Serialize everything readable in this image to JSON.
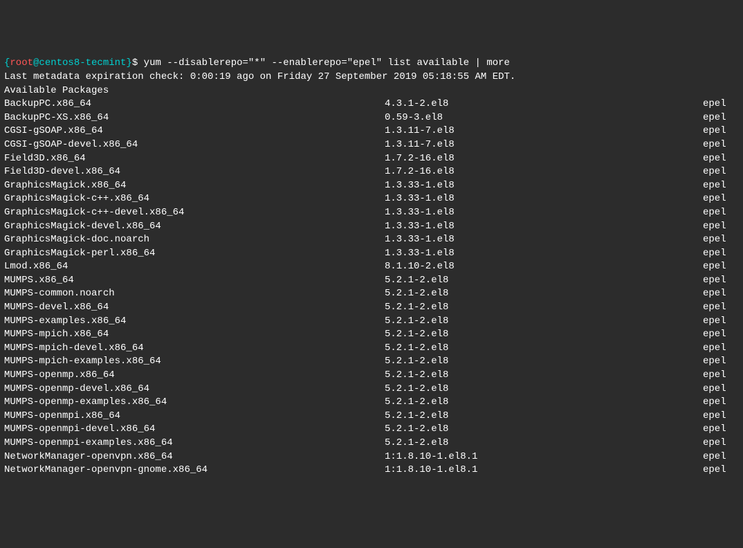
{
  "prompt": {
    "open_brace": "{",
    "user": "root",
    "at": "@",
    "host": "centos8-tecmint",
    "close_brace": "}",
    "dollar": "$ "
  },
  "command": "yum --disablerepo=\"*\" --enablerepo=\"epel\" list available | more",
  "meta_line": "Last metadata expiration check: 0:00:19 ago on Friday 27 September 2019 05:18:55 AM EDT.",
  "header": "Available Packages",
  "packages": [
    {
      "name": "BackupPC.x86_64",
      "version": "4.3.1-2.el8",
      "repo": "epel"
    },
    {
      "name": "BackupPC-XS.x86_64",
      "version": "0.59-3.el8",
      "repo": "epel"
    },
    {
      "name": "CGSI-gSOAP.x86_64",
      "version": "1.3.11-7.el8",
      "repo": "epel"
    },
    {
      "name": "CGSI-gSOAP-devel.x86_64",
      "version": "1.3.11-7.el8",
      "repo": "epel"
    },
    {
      "name": "Field3D.x86_64",
      "version": "1.7.2-16.el8",
      "repo": "epel"
    },
    {
      "name": "Field3D-devel.x86_64",
      "version": "1.7.2-16.el8",
      "repo": "epel"
    },
    {
      "name": "GraphicsMagick.x86_64",
      "version": "1.3.33-1.el8",
      "repo": "epel"
    },
    {
      "name": "GraphicsMagick-c++.x86_64",
      "version": "1.3.33-1.el8",
      "repo": "epel"
    },
    {
      "name": "GraphicsMagick-c++-devel.x86_64",
      "version": "1.3.33-1.el8",
      "repo": "epel"
    },
    {
      "name": "GraphicsMagick-devel.x86_64",
      "version": "1.3.33-1.el8",
      "repo": "epel"
    },
    {
      "name": "GraphicsMagick-doc.noarch",
      "version": "1.3.33-1.el8",
      "repo": "epel"
    },
    {
      "name": "GraphicsMagick-perl.x86_64",
      "version": "1.3.33-1.el8",
      "repo": "epel"
    },
    {
      "name": "Lmod.x86_64",
      "version": "8.1.10-2.el8",
      "repo": "epel"
    },
    {
      "name": "MUMPS.x86_64",
      "version": "5.2.1-2.el8",
      "repo": "epel"
    },
    {
      "name": "MUMPS-common.noarch",
      "version": "5.2.1-2.el8",
      "repo": "epel"
    },
    {
      "name": "MUMPS-devel.x86_64",
      "version": "5.2.1-2.el8",
      "repo": "epel"
    },
    {
      "name": "MUMPS-examples.x86_64",
      "version": "5.2.1-2.el8",
      "repo": "epel"
    },
    {
      "name": "MUMPS-mpich.x86_64",
      "version": "5.2.1-2.el8",
      "repo": "epel"
    },
    {
      "name": "MUMPS-mpich-devel.x86_64",
      "version": "5.2.1-2.el8",
      "repo": "epel"
    },
    {
      "name": "MUMPS-mpich-examples.x86_64",
      "version": "5.2.1-2.el8",
      "repo": "epel"
    },
    {
      "name": "MUMPS-openmp.x86_64",
      "version": "5.2.1-2.el8",
      "repo": "epel"
    },
    {
      "name": "MUMPS-openmp-devel.x86_64",
      "version": "5.2.1-2.el8",
      "repo": "epel"
    },
    {
      "name": "MUMPS-openmp-examples.x86_64",
      "version": "5.2.1-2.el8",
      "repo": "epel"
    },
    {
      "name": "MUMPS-openmpi.x86_64",
      "version": "5.2.1-2.el8",
      "repo": "epel"
    },
    {
      "name": "MUMPS-openmpi-devel.x86_64",
      "version": "5.2.1-2.el8",
      "repo": "epel"
    },
    {
      "name": "MUMPS-openmpi-examples.x86_64",
      "version": "5.2.1-2.el8",
      "repo": "epel"
    },
    {
      "name": "NetworkManager-openvpn.x86_64",
      "version": "1:1.8.10-1.el8.1",
      "repo": "epel"
    },
    {
      "name": "NetworkManager-openvpn-gnome.x86_64",
      "version": "1:1.8.10-1.el8.1",
      "repo": "epel"
    }
  ]
}
